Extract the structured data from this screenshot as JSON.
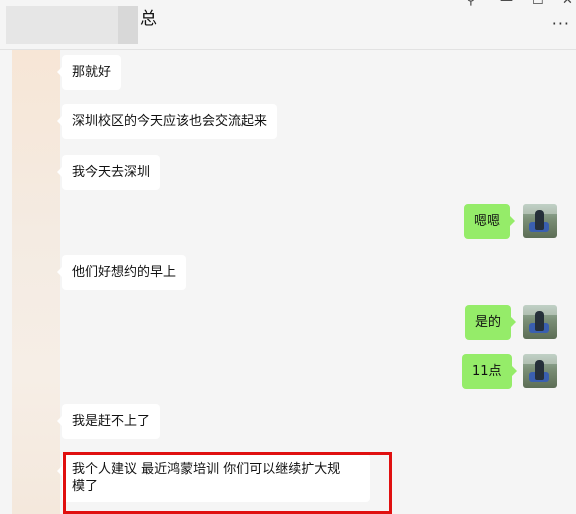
{
  "header": {
    "title_suffix": "总"
  },
  "window_controls": {
    "pin": "⚲",
    "minimize": "—",
    "maximize": "☐",
    "close": "✕",
    "more": "···"
  },
  "messages": [
    {
      "side": "in",
      "text": "那就好"
    },
    {
      "side": "in",
      "text": "深圳校区的今天应该也会交流起来"
    },
    {
      "side": "in",
      "text": "我今天去深圳"
    },
    {
      "side": "out",
      "text": "嗯嗯"
    },
    {
      "side": "in",
      "text": "他们好想约的早上"
    },
    {
      "side": "out",
      "text": "是的"
    },
    {
      "side": "out",
      "text": "11点"
    },
    {
      "side": "in",
      "text": "我是赶不上了"
    },
    {
      "side": "in",
      "text_line1": "我个人建议 最近鸿蒙培训 你们可以继续扩大规",
      "text_line2": "模了"
    }
  ],
  "colors": {
    "outgoing_bubble": "#95ec69",
    "incoming_bubble": "#ffffff",
    "highlight_border": "#e01010",
    "background": "#f5f5f5"
  }
}
